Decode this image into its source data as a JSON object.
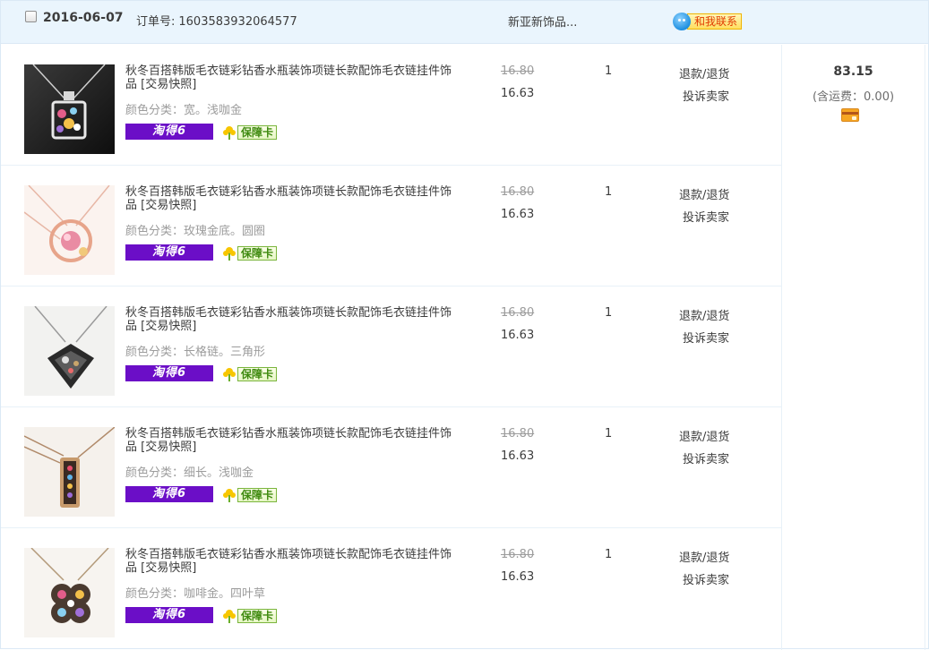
{
  "order": {
    "date": "2016-06-07",
    "order_no_label": "订单号:",
    "order_no": "1603583932064577",
    "shop_name": "新亚新饰品...",
    "contact_label": "和我联系",
    "total": "83.15",
    "shipping": "(含运费：0.00)"
  },
  "items": [
    {
      "title": "秋冬百搭韩版毛衣链彩钻香水瓶装饰项链长款配饰毛衣链挂件饰品",
      "snapshot": "[交易快照]",
      "sku_label": "颜色分类：",
      "sku_value": "宽。浅咖金",
      "badge_tao": "淘得6",
      "badge_guard": "保障卡",
      "price_orig": "16.80",
      "price_now": "16.63",
      "qty": "1",
      "refund": "退款/退货",
      "complain": "投诉卖家"
    },
    {
      "title": "秋冬百搭韩版毛衣链彩钻香水瓶装饰项链长款配饰毛衣链挂件饰品",
      "snapshot": "[交易快照]",
      "sku_label": "颜色分类：",
      "sku_value": "玫瑰金底。圆圈",
      "badge_tao": "淘得6",
      "badge_guard": "保障卡",
      "price_orig": "16.80",
      "price_now": "16.63",
      "qty": "1",
      "refund": "退款/退货",
      "complain": "投诉卖家"
    },
    {
      "title": "秋冬百搭韩版毛衣链彩钻香水瓶装饰项链长款配饰毛衣链挂件饰品",
      "snapshot": "[交易快照]",
      "sku_label": "颜色分类：",
      "sku_value": "长格链。三角形",
      "badge_tao": "淘得6",
      "badge_guard": "保障卡",
      "price_orig": "16.80",
      "price_now": "16.63",
      "qty": "1",
      "refund": "退款/退货",
      "complain": "投诉卖家"
    },
    {
      "title": "秋冬百搭韩版毛衣链彩钻香水瓶装饰项链长款配饰毛衣链挂件饰品",
      "snapshot": "[交易快照]",
      "sku_label": "颜色分类：",
      "sku_value": "细长。浅咖金",
      "badge_tao": "淘得6",
      "badge_guard": "保障卡",
      "price_orig": "16.80",
      "price_now": "16.63",
      "qty": "1",
      "refund": "退款/退货",
      "complain": "投诉卖家"
    },
    {
      "title": "秋冬百搭韩版毛衣链彩钻香水瓶装饰项链长款配饰毛衣链挂件饰品",
      "snapshot": "[交易快照]",
      "sku_label": "颜色分类：",
      "sku_value": "咖啡金。四叶草",
      "badge_tao": "淘得6",
      "badge_guard": "保障卡",
      "price_orig": "16.80",
      "price_now": "16.63",
      "qty": "1",
      "refund": "退款/退货",
      "complain": "投诉卖家"
    }
  ],
  "icons": {
    "checkbox": "checkbox-icon",
    "contact": "chat-avatar-icon",
    "guard": "shield-flower-icon",
    "card": "credit-card-icon"
  },
  "colors": {
    "header_bg": "#eaf5fd",
    "border": "#dbe9f5",
    "tao_badge": "#6b0ec7",
    "guard_green": "#3f8a0f",
    "contact_red": "#e03a00"
  }
}
